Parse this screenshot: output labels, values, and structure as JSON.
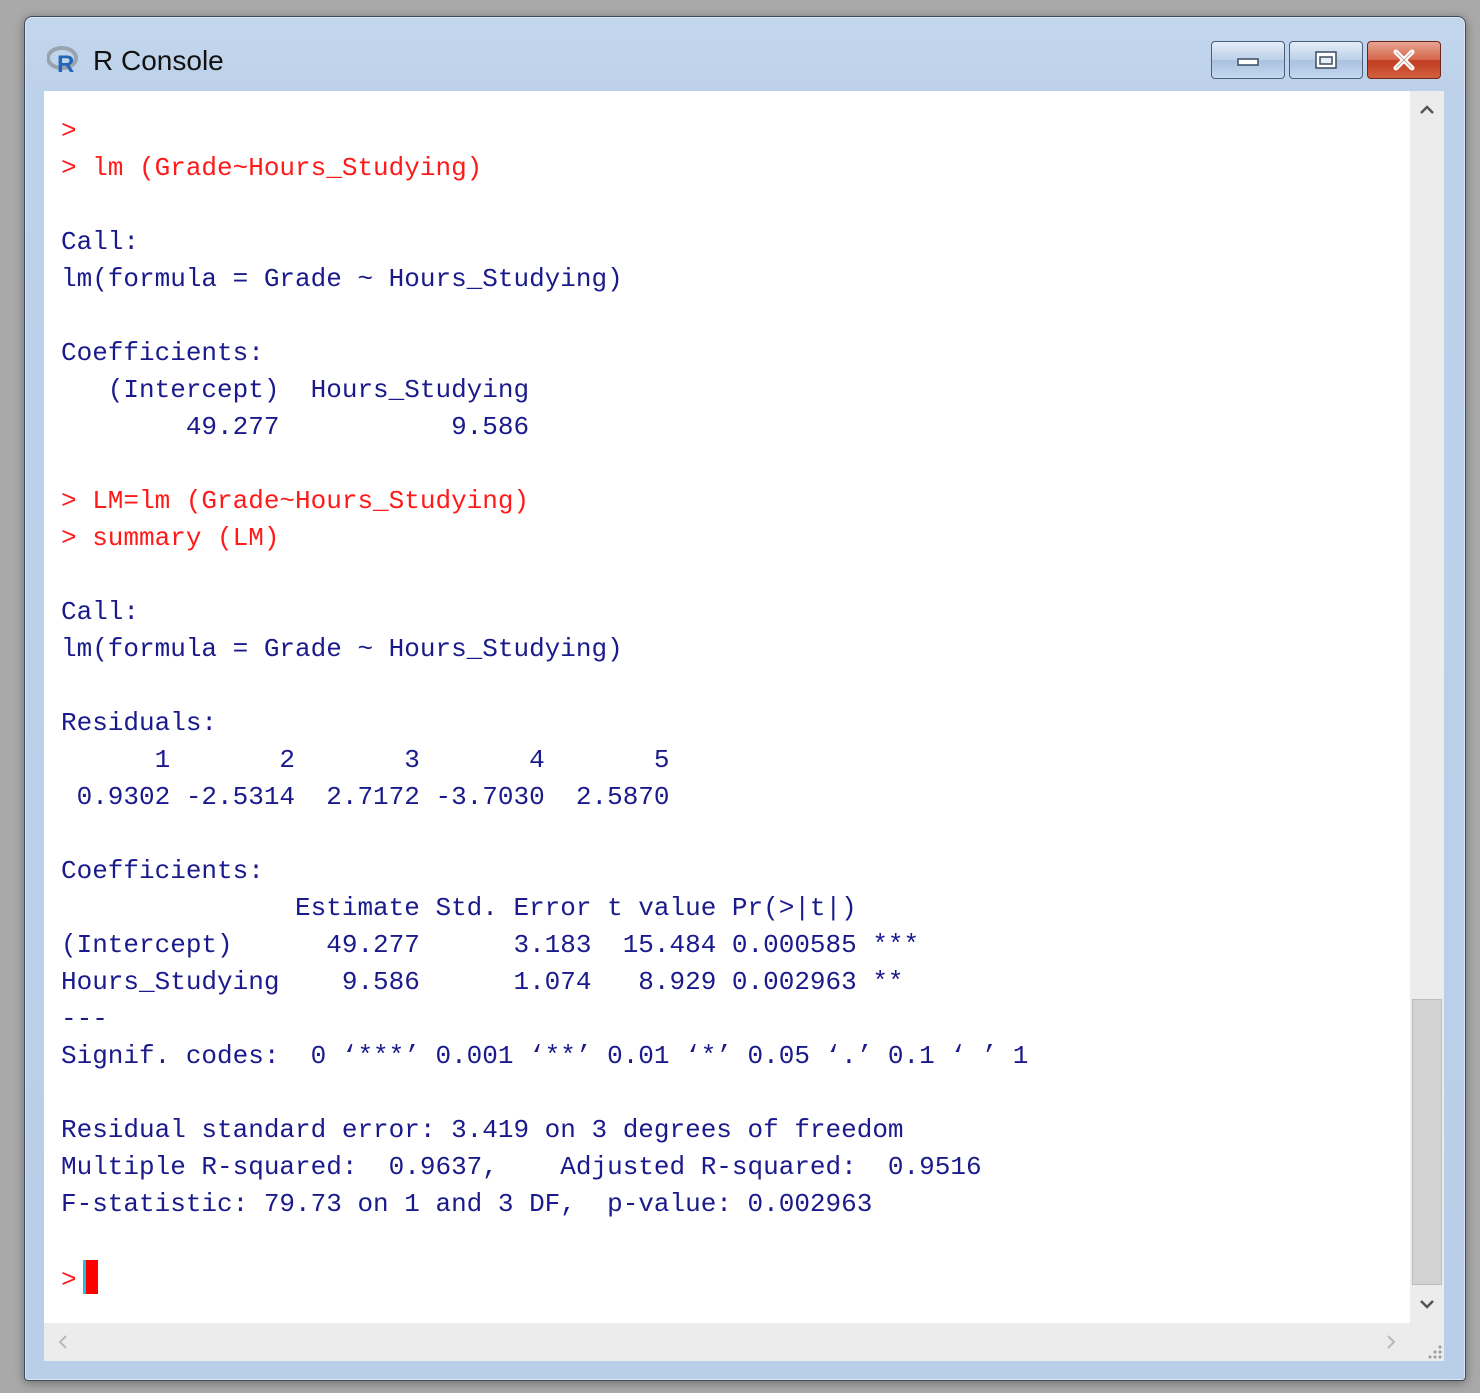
{
  "window": {
    "title": "R Console",
    "icon": "r-logo-icon",
    "controls": {
      "minimize": "minimize-icon",
      "maximize": "maximize-icon",
      "close": "close-icon"
    }
  },
  "console": {
    "lines": [
      {
        "kind": "in",
        "text": ">"
      },
      {
        "kind": "in",
        "text": "> lm (Grade~Hours_Studying)"
      },
      {
        "kind": "out",
        "text": ""
      },
      {
        "kind": "out",
        "text": "Call:"
      },
      {
        "kind": "out",
        "text": "lm(formula = Grade ~ Hours_Studying)"
      },
      {
        "kind": "out",
        "text": ""
      },
      {
        "kind": "out",
        "text": "Coefficients:"
      },
      {
        "kind": "out",
        "text": "   (Intercept)  Hours_Studying  "
      },
      {
        "kind": "out",
        "text": "        49.277           9.586  "
      },
      {
        "kind": "out",
        "text": ""
      },
      {
        "kind": "in",
        "text": "> LM=lm (Grade~Hours_Studying)"
      },
      {
        "kind": "in",
        "text": "> summary (LM)"
      },
      {
        "kind": "out",
        "text": ""
      },
      {
        "kind": "out",
        "text": "Call:"
      },
      {
        "kind": "out",
        "text": "lm(formula = Grade ~ Hours_Studying)"
      },
      {
        "kind": "out",
        "text": ""
      },
      {
        "kind": "out",
        "text": "Residuals:"
      },
      {
        "kind": "out",
        "text": "      1       2       3       4       5 "
      },
      {
        "kind": "out",
        "text": " 0.9302 -2.5314  2.7172 -3.7030  2.5870 "
      },
      {
        "kind": "out",
        "text": ""
      },
      {
        "kind": "out",
        "text": "Coefficients:"
      },
      {
        "kind": "out",
        "text": "               Estimate Std. Error t value Pr(>|t|)    "
      },
      {
        "kind": "out",
        "text": "(Intercept)      49.277      3.183  15.484 0.000585 ***"
      },
      {
        "kind": "out",
        "text": "Hours_Studying    9.586      1.074   8.929 0.002963 ** "
      },
      {
        "kind": "out",
        "text": "---"
      },
      {
        "kind": "out",
        "text": "Signif. codes:  0 ‘***’ 0.001 ‘**’ 0.01 ‘*’ 0.05 ‘.’ 0.1 ‘ ’ 1"
      },
      {
        "kind": "out",
        "text": ""
      },
      {
        "kind": "out",
        "text": "Residual standard error: 3.419 on 3 degrees of freedom"
      },
      {
        "kind": "out",
        "text": "Multiple R-squared:  0.9637,    Adjusted R-squared:  0.9516 "
      },
      {
        "kind": "out",
        "text": "F-statistic: 79.73 on 1 and 3 DF,  p-value: 0.002963"
      },
      {
        "kind": "out",
        "text": ""
      }
    ],
    "prompt": ">"
  },
  "colors": {
    "input_text": "#ff1a1a",
    "output_text": "#1a1a8c",
    "cursor": "#ff0000"
  },
  "scrollbars": {
    "vertical": {
      "up": "chevron-up-icon",
      "down": "chevron-down-icon"
    },
    "horizontal": {
      "left": "chevron-left-icon",
      "right": "chevron-right-icon"
    }
  }
}
